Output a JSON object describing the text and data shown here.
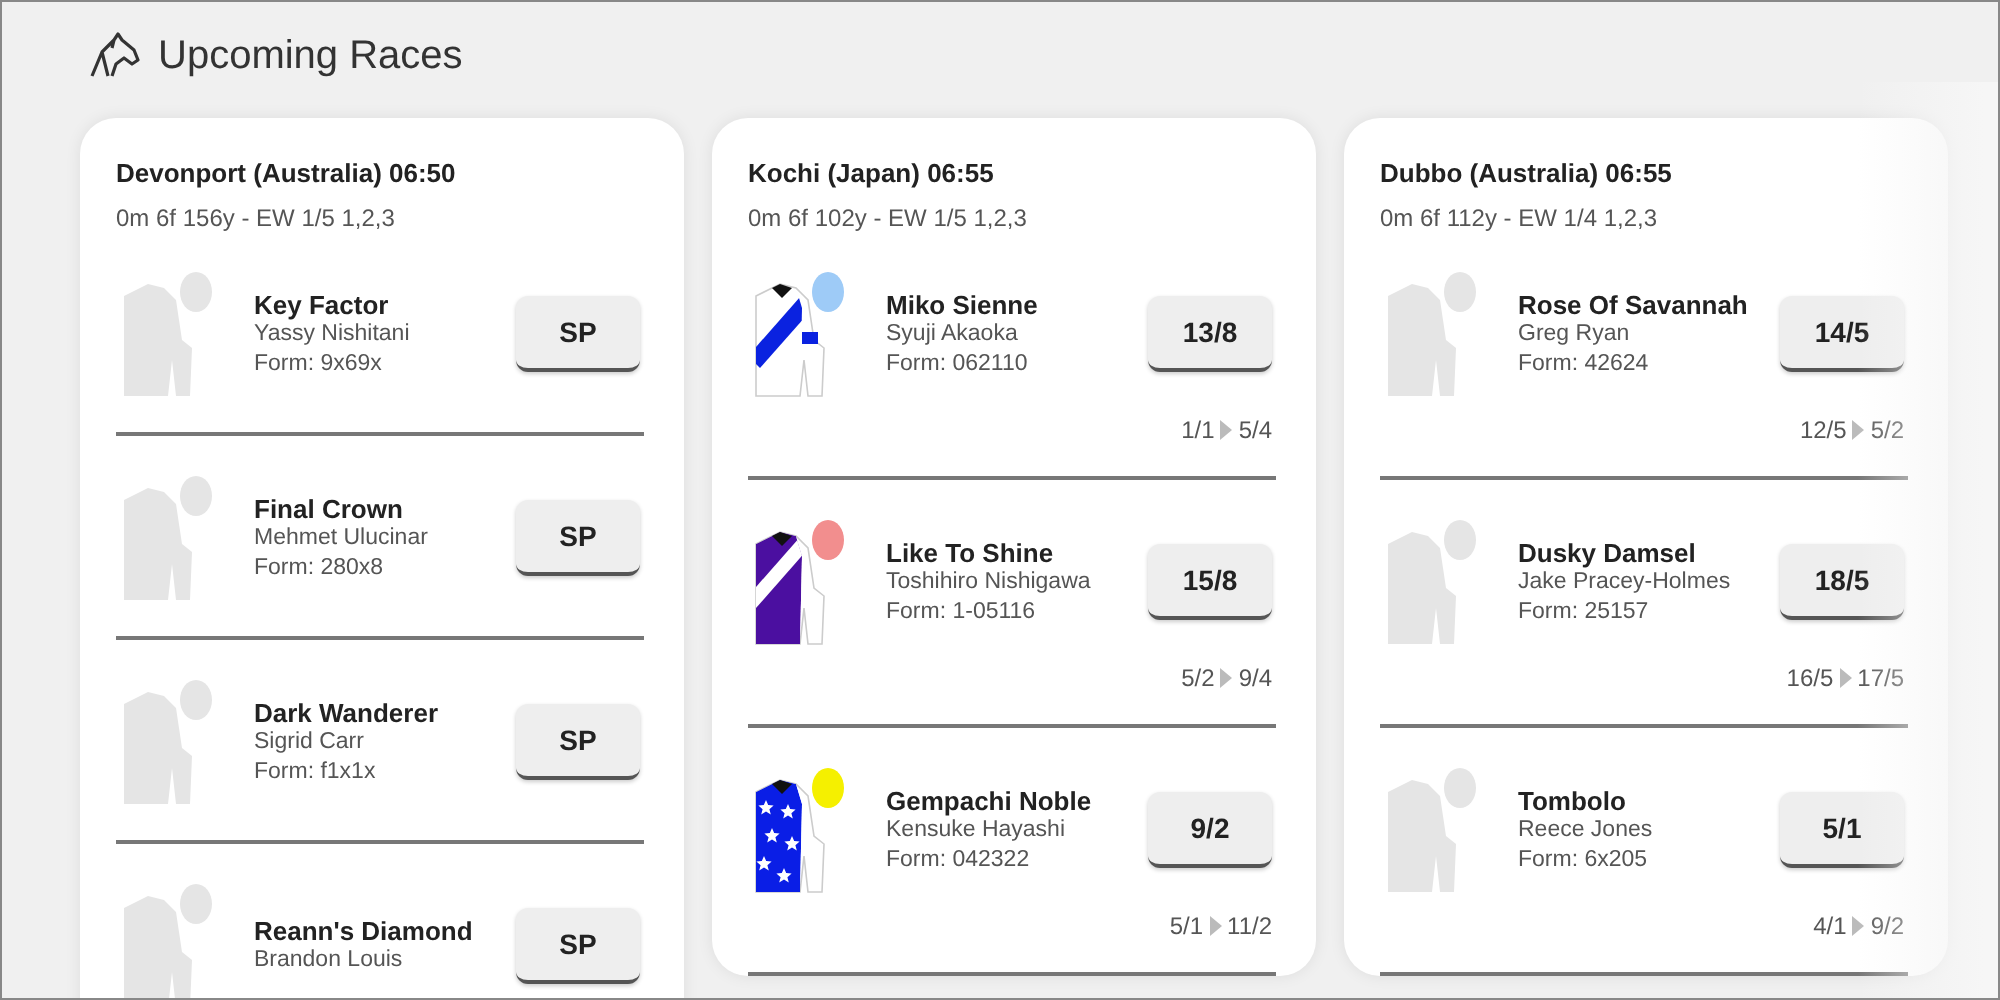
{
  "page": {
    "title": "Upcoming Races"
  },
  "races": [
    {
      "title": "Devonport (Australia) 06:50",
      "details": "0m 6f 156y - EW 1/5 1,2,3",
      "runners": [
        {
          "name": "Key Factor",
          "jockey": "Yassy Nishitani",
          "form": "Form: 9x69x",
          "price": "SP",
          "silk": {
            "kind": "generic"
          }
        },
        {
          "name": "Final Crown",
          "jockey": "Mehmet Ulucinar",
          "form": "Form: 280x8",
          "price": "SP",
          "silk": {
            "kind": "generic"
          }
        },
        {
          "name": "Dark Wanderer",
          "jockey": "Sigrid Carr",
          "form": "Form: f1x1x",
          "price": "SP",
          "silk": {
            "kind": "generic"
          }
        },
        {
          "name": "Reann's Diamond",
          "jockey": "Brandon Louis",
          "price": "SP",
          "silk": {
            "kind": "generic"
          }
        }
      ]
    },
    {
      "title": "Kochi (Japan) 06:55",
      "details": "0m 6f 102y - EW 1/5 1,2,3",
      "runners": [
        {
          "name": "Miko Sienne",
          "jockey": "Syuji Akaoka",
          "form": "Form: 062110",
          "price": "13/8",
          "history": {
            "from": "1/1",
            "to": "5/4"
          },
          "silk": {
            "kind": "sash",
            "color": "#0a22e0"
          },
          "cap": {
            "color": "#9ecbf7"
          }
        },
        {
          "name": "Like To Shine",
          "jockey": "Toshihiro Nishigawa",
          "form": "Form: 1-05116",
          "price": "15/8",
          "history": {
            "from": "5/2",
            "to": "9/4"
          },
          "silk": {
            "kind": "body-sash",
            "color": "#4b0fa0"
          },
          "cap": {
            "color": "#f28e8e"
          }
        },
        {
          "name": "Gempachi Noble",
          "jockey": "Kensuke Hayashi",
          "form": "Form: 042322",
          "price": "9/2",
          "history": {
            "from": "5/1",
            "to": "11/2"
          },
          "silk": {
            "kind": "stars",
            "color": "#0a1ee6"
          },
          "cap": {
            "color": "#f5f000"
          }
        }
      ]
    },
    {
      "title": "Dubbo (Australia) 06:55",
      "details": "0m 6f 112y - EW 1/4 1,2,3",
      "runners": [
        {
          "name": "Rose Of Savannah",
          "jockey": "Greg Ryan",
          "form": "Form: 42624",
          "price": "14/5",
          "history": {
            "from": "12/5",
            "to": "5/2"
          },
          "silk": {
            "kind": "generic"
          }
        },
        {
          "name": "Dusky Damsel",
          "jockey": "Jake Pracey-Holmes",
          "form": "Form: 25157",
          "price": "18/5",
          "history": {
            "from": "16/5",
            "to": "17/5"
          },
          "silk": {
            "kind": "generic"
          }
        },
        {
          "name": "Tombolo",
          "jockey": "Reece Jones",
          "form": "Form: 6x205",
          "price": "5/1",
          "history": {
            "from": "4/1",
            "to": "9/2"
          },
          "silk": {
            "kind": "generic"
          }
        }
      ]
    }
  ]
}
